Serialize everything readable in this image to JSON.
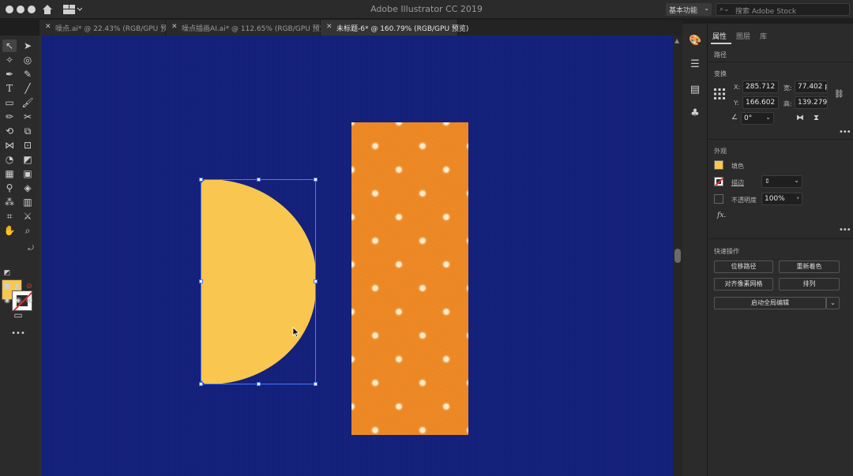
{
  "window": {
    "app_title": "Adobe Illustrator CC 2019",
    "workspace_label": "基本功能",
    "stock_placeholder": "搜索 Adobe Stock"
  },
  "tabs": [
    {
      "label": "噪点.ai* @ 22.43% (RGB/GPU 预览)",
      "active": false
    },
    {
      "label": "噪点插画AI.ai* @ 112.65% (RGB/GPU 预览)",
      "active": false
    },
    {
      "label": "未标题-6* @ 160.79% (RGB/GPU 预览)",
      "active": true
    }
  ],
  "colors": {
    "artboard": "#13207a",
    "shape_yellow": "#f9c74f",
    "pattern_orange": "#ef8a25",
    "selection_blue": "#4a78ff"
  },
  "panel": {
    "tabs": [
      "属性",
      "图层",
      "库"
    ],
    "section_path": "路径",
    "section_transform": "变换",
    "transform": {
      "x_label": "X:",
      "x_value": "285.712",
      "y_label": "Y:",
      "y_value": "166.602",
      "w_label": "宽:",
      "w_value": "77.402 p",
      "h_label": "高:",
      "h_value": "139.279",
      "angle_value": "0°"
    },
    "section_appearance": "外观",
    "appearance": {
      "fill_label": "填色",
      "stroke_label": "描边",
      "opacity_label": "不透明度",
      "opacity_value": "100%",
      "fx_label": "fx."
    },
    "section_quick_actions": "快速操作",
    "quick_actions": {
      "offset_path": "位移路径",
      "recolor": "重新着色",
      "align_pixel_grid": "对齐像素网格",
      "arrange": "排列",
      "global_edit": "启动全局编辑"
    }
  }
}
